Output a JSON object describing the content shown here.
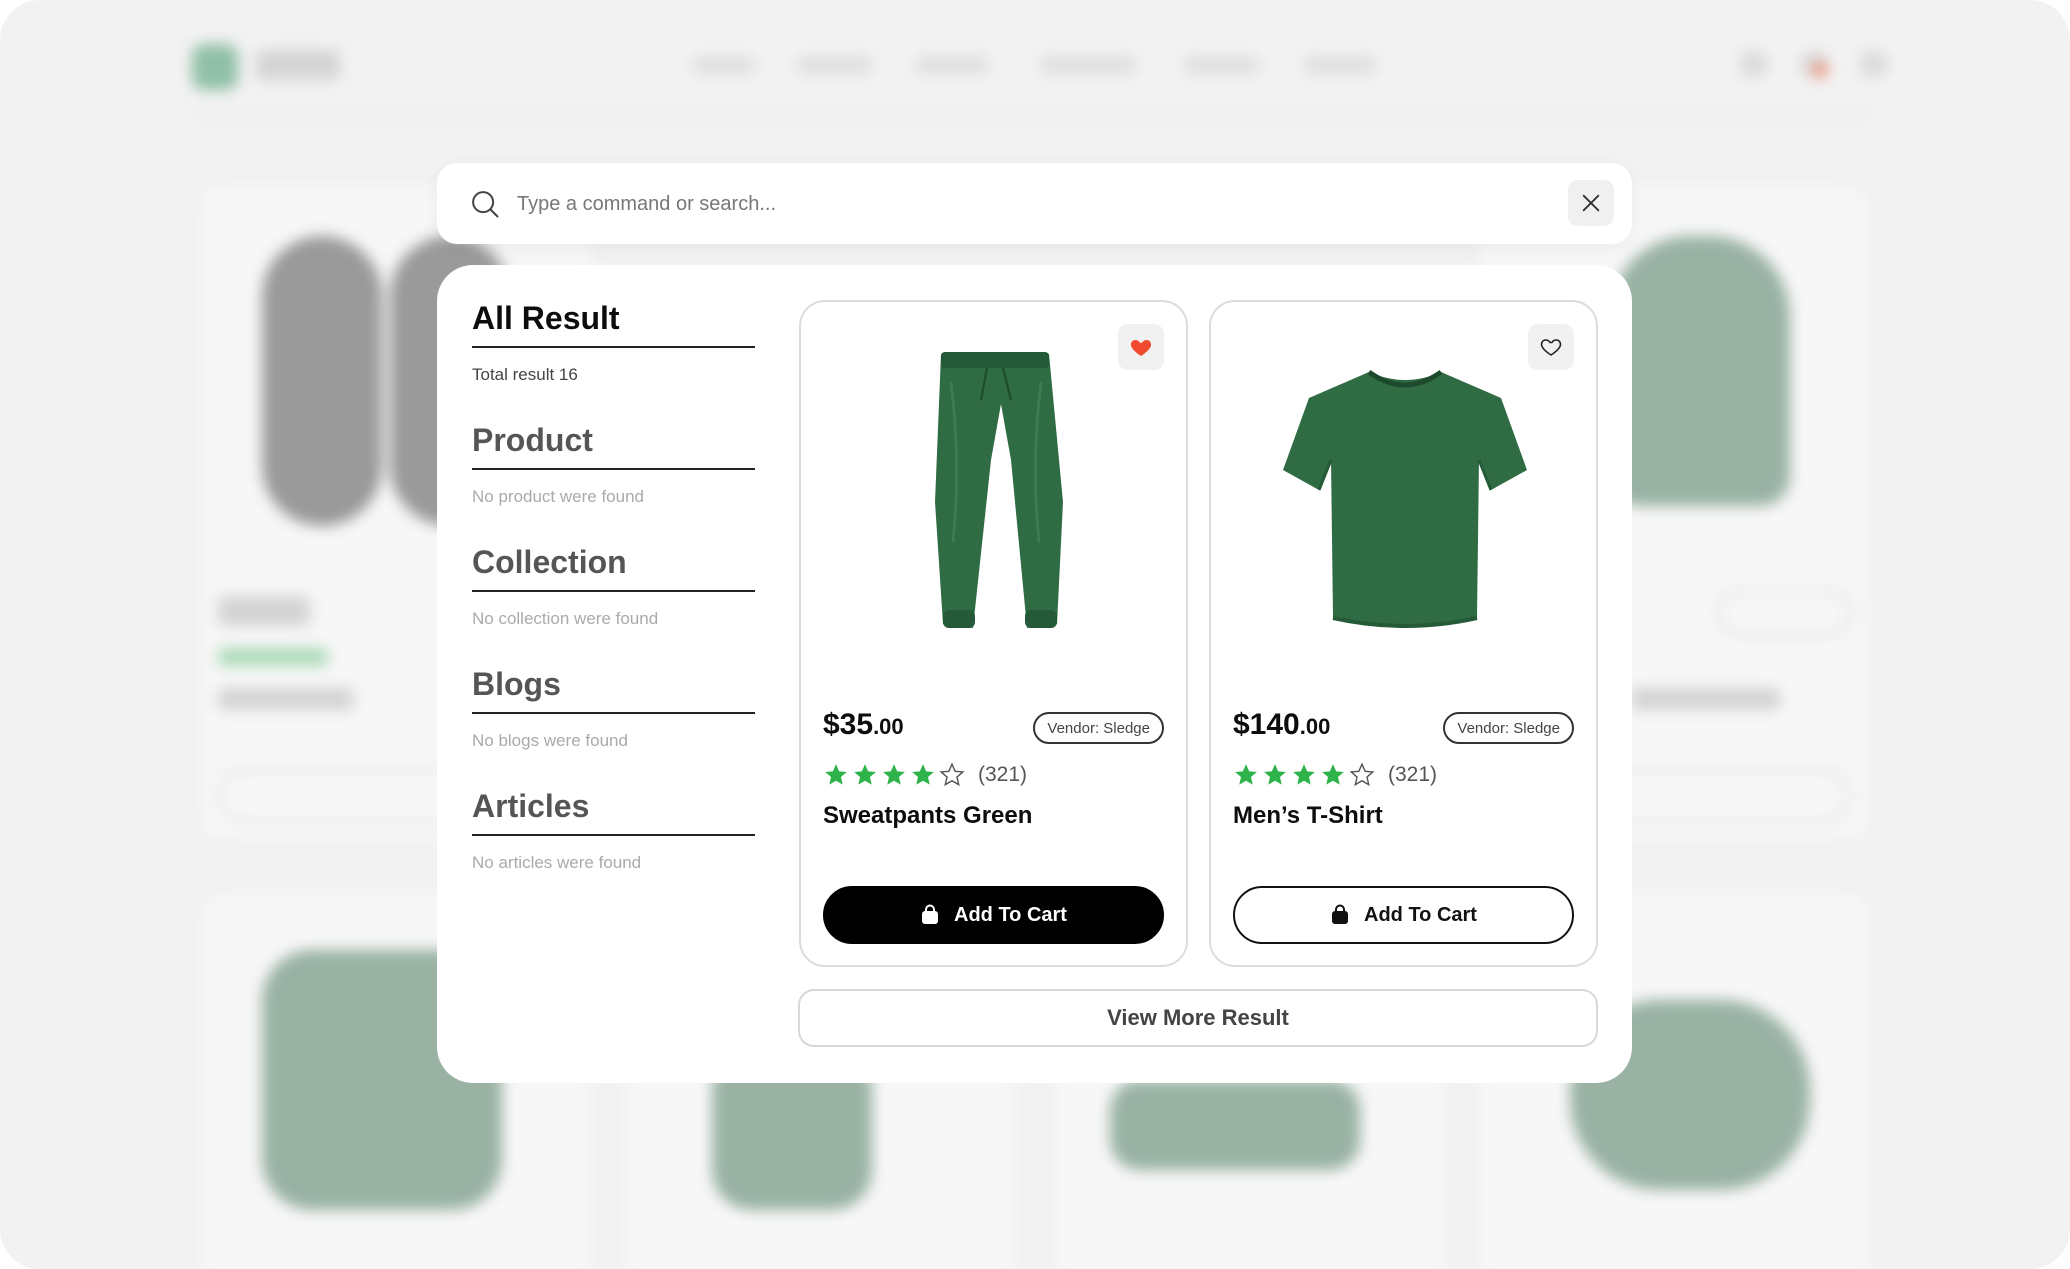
{
  "search": {
    "placeholder": "Type a command or search...",
    "value": ""
  },
  "sidebar": {
    "sections": [
      {
        "title": "All Result",
        "subtitle": "Total result 16",
        "active": true
      },
      {
        "title": "Product",
        "subtitle": "No product were found",
        "active": false
      },
      {
        "title": "Collection",
        "subtitle": "No collection were found",
        "active": false
      },
      {
        "title": "Blogs",
        "subtitle": "No blogs were found",
        "active": false
      },
      {
        "title": "Articles",
        "subtitle": "No articles were found",
        "active": false
      }
    ]
  },
  "products": [
    {
      "name": "Sweatpants Green",
      "price_main": "$35",
      "price_cents": ".00",
      "vendor": "Vendor: Sledge",
      "rating": 4,
      "rating_max": 5,
      "reviews": "(321)",
      "favorited": true,
      "cart_label": "Add To Cart",
      "image": "green-sweatpants"
    },
    {
      "name": "Men’s T-Shirt",
      "price_main": "$140",
      "price_cents": ".00",
      "vendor": "Vendor: Sledge",
      "rating": 4,
      "rating_max": 5,
      "reviews": "(321)",
      "favorited": false,
      "cart_label": "Add To Cart",
      "image": "green-tshirt"
    }
  ],
  "view_more_label": "View More Result",
  "colors": {
    "star": "#2db34a",
    "favorite_active": "#f04b2f",
    "product_green": "#2f6b43"
  },
  "icons": {
    "search": "search-icon",
    "close": "close-icon",
    "favorite": "heart-icon",
    "cart": "shopping-bag-icon",
    "rating": "star-icon"
  }
}
